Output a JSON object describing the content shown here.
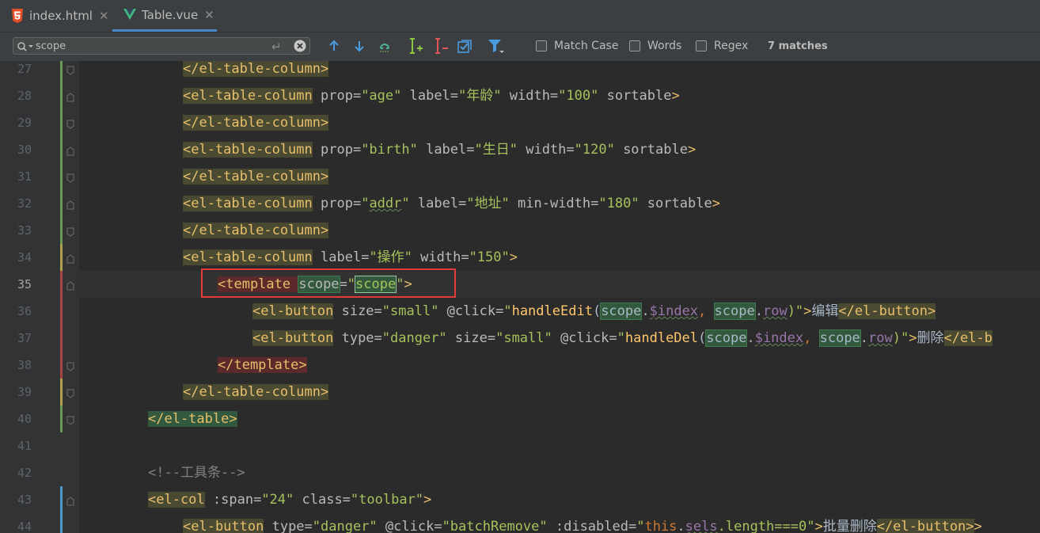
{
  "tabs": [
    {
      "label": "index.html",
      "icon": "html5-icon",
      "active": false
    },
    {
      "label": "Table.vue",
      "icon": "vue-icon",
      "active": true
    }
  ],
  "search": {
    "value": "scope",
    "match_count": "7 matches",
    "options": [
      {
        "label": "Match Case",
        "checked": false
      },
      {
        "label": "Words",
        "checked": false
      },
      {
        "label": "Regex",
        "checked": false
      }
    ]
  },
  "editor": {
    "current_line": "35",
    "lines": [
      {
        "n": "27"
      },
      {
        "n": "28"
      },
      {
        "n": "29"
      },
      {
        "n": "30"
      },
      {
        "n": "31"
      },
      {
        "n": "32"
      },
      {
        "n": "33"
      },
      {
        "n": "34"
      },
      {
        "n": "35"
      },
      {
        "n": "36"
      },
      {
        "n": "37"
      },
      {
        "n": "38"
      },
      {
        "n": "39"
      },
      {
        "n": "40"
      },
      {
        "n": "41"
      },
      {
        "n": "42"
      },
      {
        "n": "43"
      },
      {
        "n": "44"
      }
    ],
    "code": {
      "l27": {
        "close": "</el-table-column>"
      },
      "l28": {
        "open": "<el-table-column",
        "a1": " prop=",
        "v1": "\"age\"",
        "a2": " label=",
        "v2": "\"年龄\"",
        "a3": " width=",
        "v3": "\"100\"",
        "a4": " sortable",
        "end": ">"
      },
      "l29": {
        "close": "</el-table-column>"
      },
      "l30": {
        "open": "<el-table-column",
        "a1": " prop=",
        "v1": "\"birth\"",
        "a2": " label=",
        "v2": "\"生日\"",
        "a3": " width=",
        "v3": "\"120\"",
        "a4": " sortable",
        "end": ">"
      },
      "l31": {
        "close": "</el-table-column>"
      },
      "l32": {
        "open": "<el-table-column",
        "a1": " prop=",
        "v1q": "\"",
        "v1w": "addr",
        "v1e": "\"",
        "a2": " label=",
        "v2": "\"地址\"",
        "a3": " min-width=",
        "v3": "\"180\"",
        "a4": " sortable",
        "end": ">"
      },
      "l33": {
        "close": "</el-table-column>"
      },
      "l34": {
        "open": "<el-table-column",
        "a1": " label=",
        "v1": "\"操作\"",
        "a2": " width=",
        "v2": "\"150\"",
        "end": ">"
      },
      "l35": {
        "open": "<template ",
        "attr": "scope",
        "eq": "=",
        "q1": "\"",
        "val": "scope",
        "q2": "\"",
        "end": ">"
      },
      "l36": {
        "open": "<el-button",
        "a1": " size=",
        "v1": "\"small\"",
        "a2": " @click=",
        "q": "\"",
        "fn": "handleEdit",
        "p": "(",
        "s1": "scope",
        "d1": ".",
        "i1": "$index",
        "c": ", ",
        "s2": "scope",
        "d2": ".",
        "r": "row",
        "pe": ")\"",
        "gt": ">",
        "txt": "编辑",
        "close": "</el-button>",
        "end": ">"
      },
      "l37": {
        "open": "<el-button",
        "a1": " type=",
        "v1": "\"danger\"",
        "a2": " size=",
        "v2": "\"small\"",
        "a3": " @click=",
        "q": "\"",
        "fn": "handleDel",
        "p": "(",
        "s1": "scope",
        "d1": ".",
        "i1": "$index",
        "c": ", ",
        "s2": "scope",
        "d2": ".",
        "r": "row",
        "pe": ")\"",
        "gt": ">",
        "txt": "删除",
        "close": "</el-b"
      },
      "l38": {
        "close": "</template>"
      },
      "l39": {
        "close": "</el-table-column>"
      },
      "l40": {
        "close": "</el-table>"
      },
      "l42": {
        "comment": "<!--工具条-->"
      },
      "l43": {
        "open": "<el-col",
        "a1": " :span=",
        "v1": "\"24\"",
        "a2": " class=",
        "v2": "\"toolbar\"",
        "end": ">"
      },
      "l44": {
        "open": "<el-button",
        "a1": " type=",
        "v1": "\"danger\"",
        "a2": " @click=",
        "v2": "\"batchRemove\"",
        "a3": " :disabled=",
        "q": "\"",
        "kw": "this",
        "d": ".",
        "w": "sels",
        "rest": ".length===0\"",
        "gt": ">",
        "txt": "批量删除",
        "close": "</el-button>",
        "end": ">"
      }
    }
  },
  "colors": {
    "background": "#2b2b2b",
    "tag": "#e8bf6a",
    "string": "#a5c25c",
    "attribute": "#bababa",
    "comment": "#808080",
    "keyword": "#cc7832",
    "function": "#ffc66d",
    "match_highlight": "#32593d",
    "annotation_box": "#e23b3b"
  }
}
